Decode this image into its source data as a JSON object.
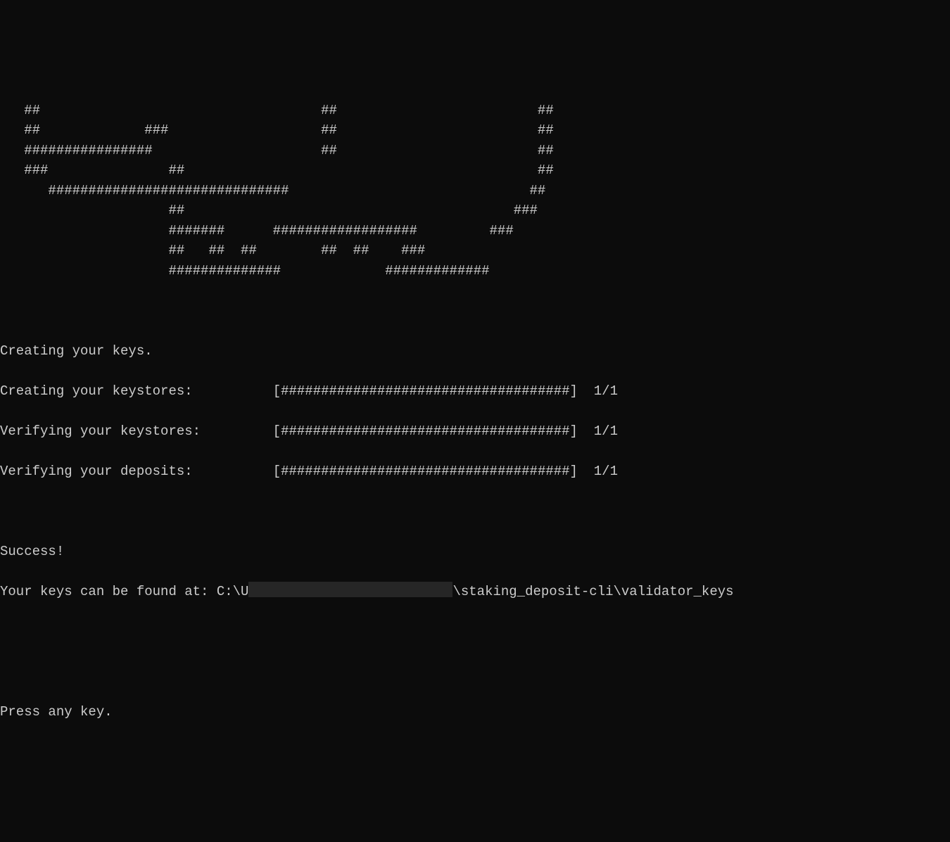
{
  "ascii_art": [
    "   ##                                   ##                         ##",
    "   ##             ###                   ##                         ##",
    "   ################                     ##                         ##",
    "   ###               ##                                            ##",
    "      ##############################                              ##",
    "                     ##                                         ###",
    "                     #######      ##################         ###",
    "                     ##   ##  ##        ##  ##    ###",
    "                     ##############             #############"
  ],
  "messages": {
    "creating_keys": "Creating your keys.",
    "success": "Success!",
    "keys_found_prefix": "Your keys can be found at: C:\\U",
    "keys_found_suffix": "\\staking_deposit-cli\\validator_keys",
    "press_key": "Press any key."
  },
  "progress": [
    {
      "label": "Creating your keystores:",
      "bar": "[####################################]",
      "counter": "1/1"
    },
    {
      "label": "Verifying your keystores:",
      "bar": "[####################################]",
      "counter": "1/1"
    },
    {
      "label": "Verifying your deposits:",
      "bar": "[####################################]",
      "counter": "1/1"
    }
  ]
}
